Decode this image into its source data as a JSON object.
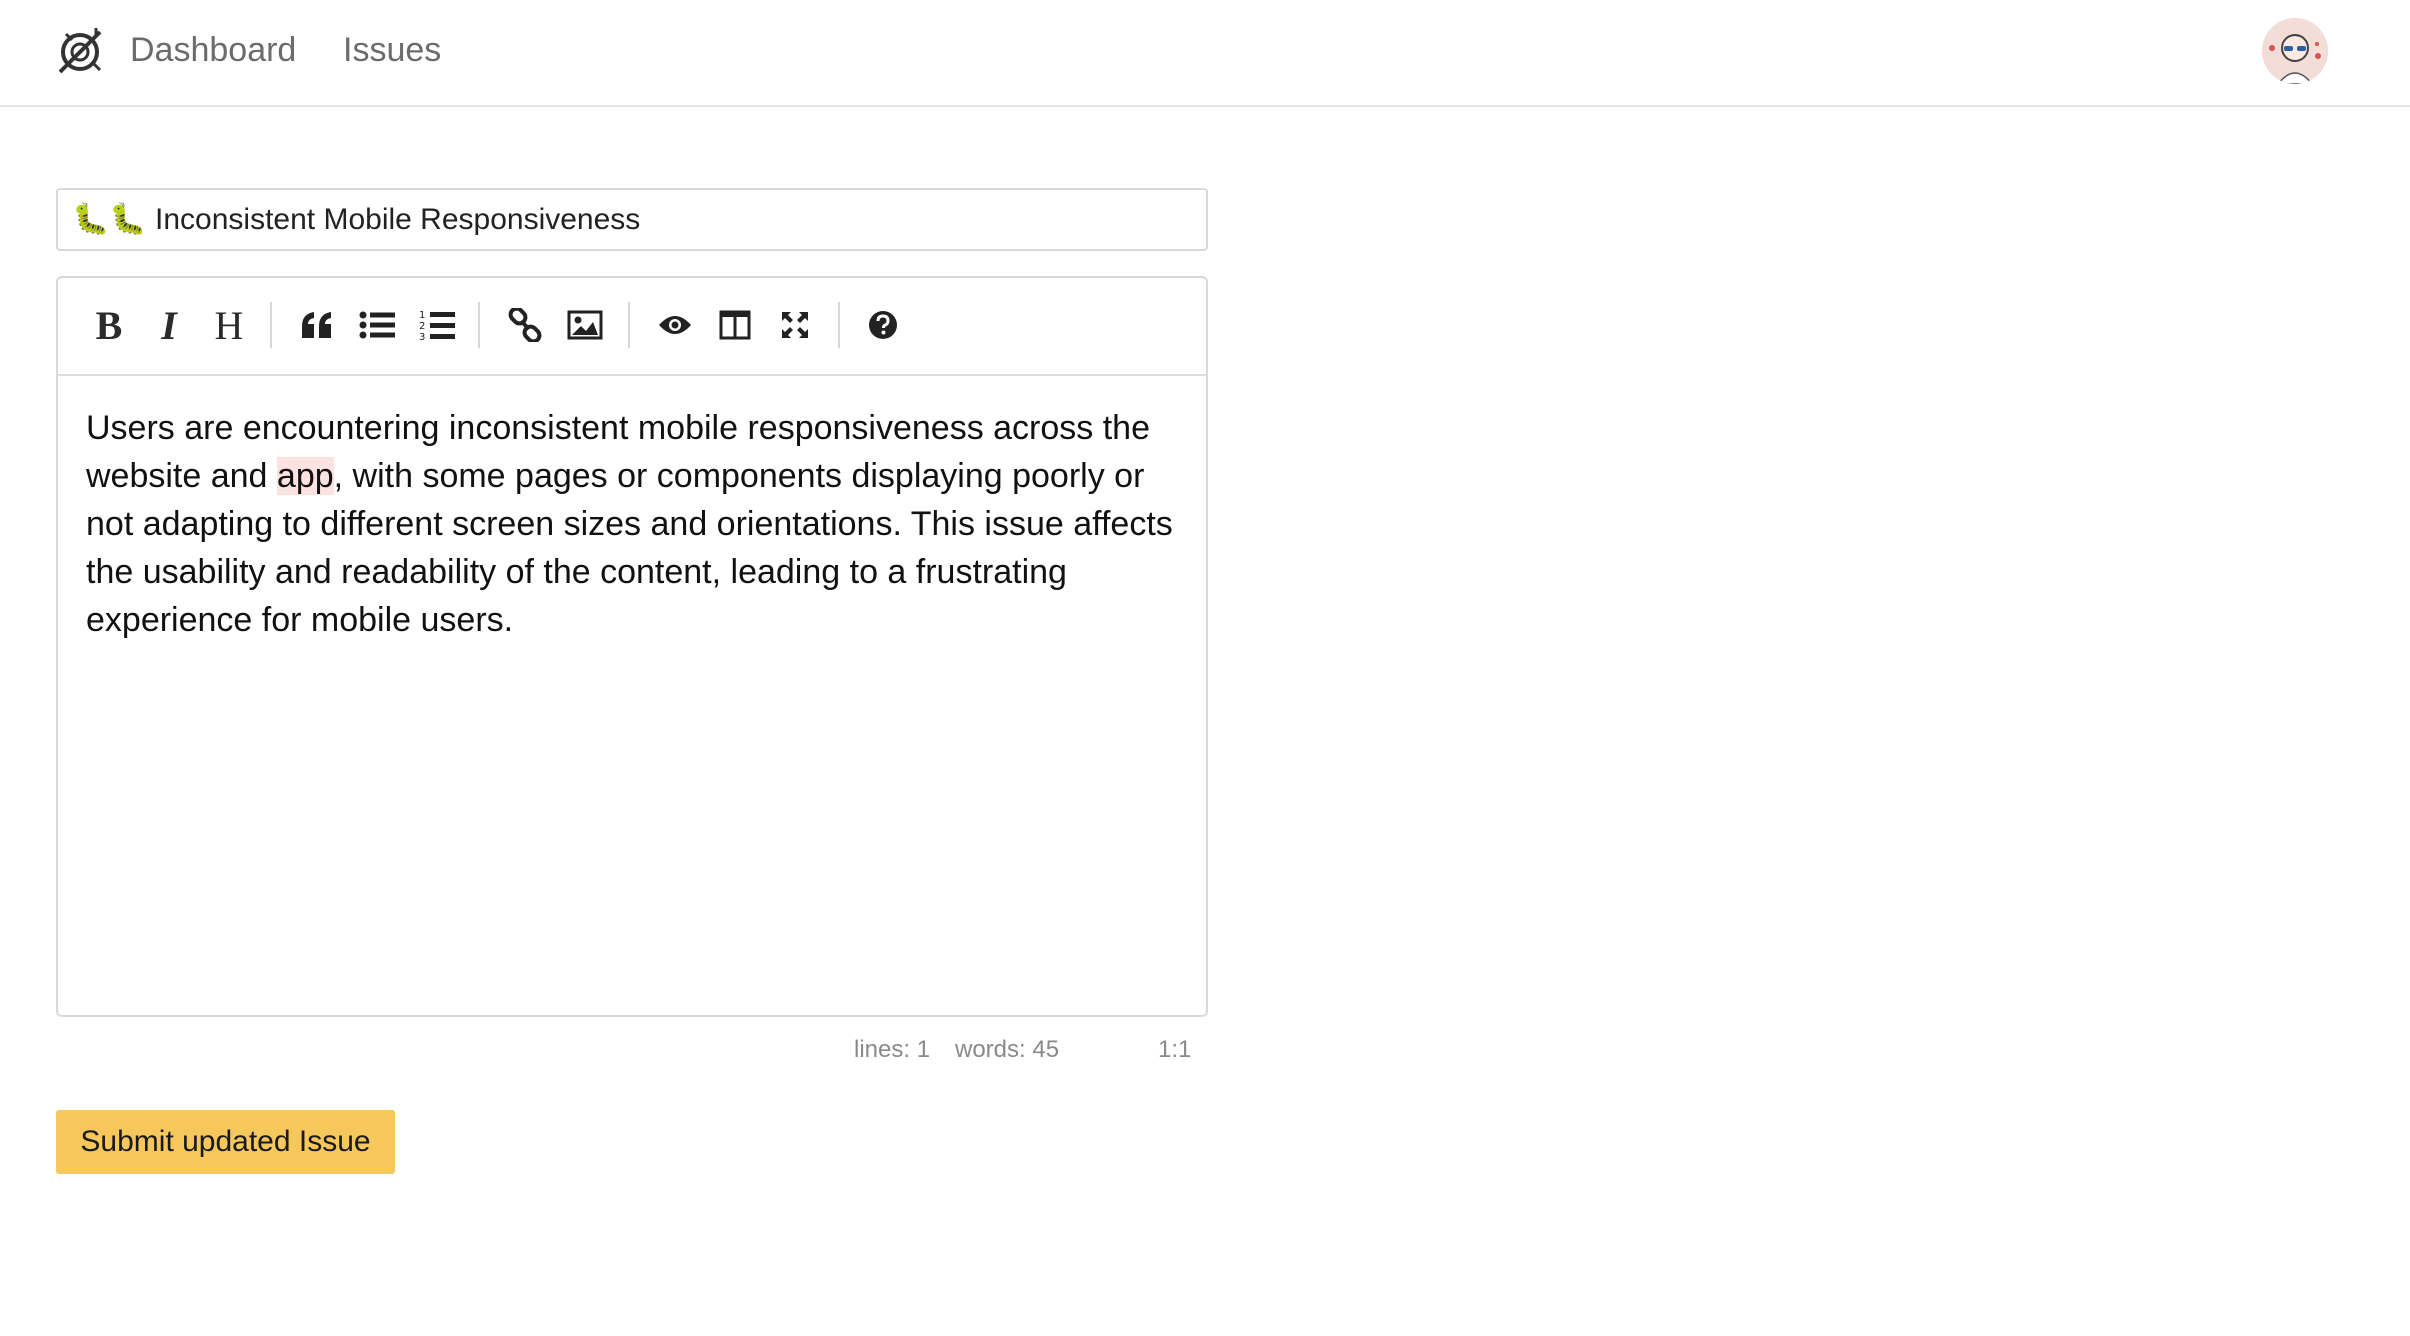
{
  "nav": {
    "dashboard": "Dashboard",
    "issues": "Issues"
  },
  "issue": {
    "title": "🐛🐛 Inconsistent Mobile Responsiveness",
    "body_before": "Users are encountering inconsistent mobile responsiveness across the website and ",
    "body_highlight": "app",
    "body_after": ", with some pages or components displaying poorly or not adapting to different screen sizes and orientations. This issue affects the usability and readability of the content, leading to a frustrating experience for mobile users."
  },
  "toolbar": {
    "bold": "B",
    "italic": "I",
    "heading": "H",
    "icons": [
      "bold-icon",
      "italic-icon",
      "heading-icon",
      "quote-icon",
      "unordered-list-icon",
      "ordered-list-icon",
      "link-icon",
      "image-icon",
      "preview-icon",
      "side-by-side-icon",
      "fullscreen-icon",
      "help-icon"
    ]
  },
  "status": {
    "lines": "lines: 1",
    "words": "words: 45",
    "cursor": "1:1"
  },
  "submit_label": "Submit updated Issue",
  "colors": {
    "submit_bg": "#f6c75b",
    "highlight_bg": "#fde2e2",
    "border": "#d9d9d9"
  }
}
